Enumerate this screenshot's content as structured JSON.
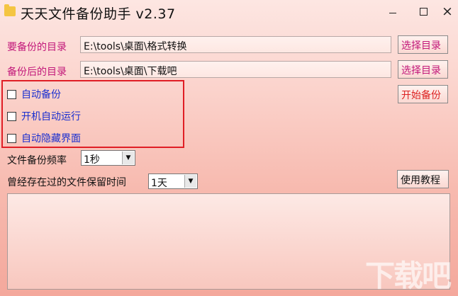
{
  "window": {
    "title": "天天文件备份助手 v2.37",
    "controls": {
      "minimize": "—",
      "maximize": "□",
      "close": "×"
    }
  },
  "source": {
    "label": "要备份的目录",
    "value": "E:\\tools\\桌面\\格式转换",
    "button": "选择目录"
  },
  "destination": {
    "label": "备份后的目录",
    "value": "E:\\tools\\桌面\\下载吧",
    "button": "选择目录"
  },
  "start_button": "开始备份",
  "options": [
    {
      "label": "自动备份",
      "checked": false
    },
    {
      "label": "开机自动运行",
      "checked": false
    },
    {
      "label": "自动隐藏界面",
      "checked": false
    }
  ],
  "frequency": {
    "label": "文件备份频率",
    "value": "1秒"
  },
  "retention": {
    "label": "曾经存在过的文件保留时间",
    "value": "1天"
  },
  "tutorial_button": "使用教程",
  "watermark": "下载吧",
  "colors": {
    "accent_label": "#c2187a",
    "start_text": "#dd2222",
    "checkbox_text": "#1a2fd0",
    "highlight_border": "#e01e25"
  }
}
